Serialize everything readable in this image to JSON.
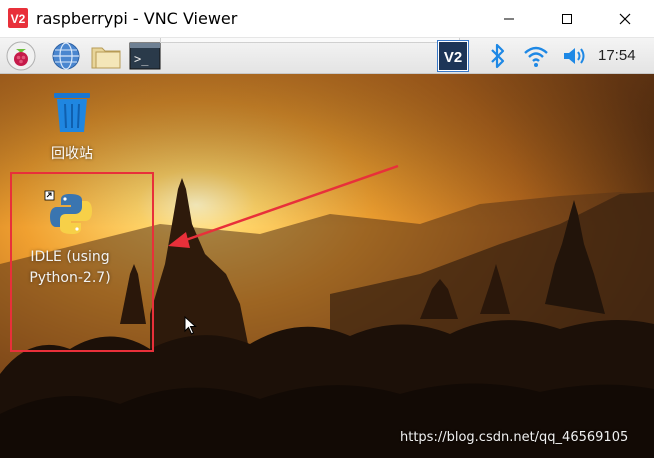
{
  "window": {
    "title": "raspberrypi - VNC Viewer",
    "app_icon": "vnc-logo-icon",
    "controls": [
      "minimize-icon",
      "maximize-icon",
      "close-icon"
    ]
  },
  "taskbar": {
    "launchers": [
      "raspberry-menu-icon",
      "web-browser-icon",
      "file-manager-icon",
      "terminal-icon"
    ],
    "tray": [
      "vnc-server-icon",
      "bluetooth-icon",
      "wifi-icon",
      "volume-icon"
    ],
    "clock": "17:54"
  },
  "desktop": {
    "icons": [
      {
        "id": "trash",
        "label": "回收站",
        "icon": "trash-icon"
      },
      {
        "id": "idle",
        "label_line1": "IDLE (using",
        "label_line2": "Python-2.7)",
        "icon": "python-icon"
      }
    ]
  },
  "annotation": {
    "color": "#e8303a",
    "shapes": [
      "highlight-box",
      "arrow"
    ]
  },
  "watermark": "https://blog.csdn.net/qq_46569105",
  "colors": {
    "accent": "#e8303a",
    "vnc": "#1d3557",
    "bluetooth": "#1e88e5"
  }
}
